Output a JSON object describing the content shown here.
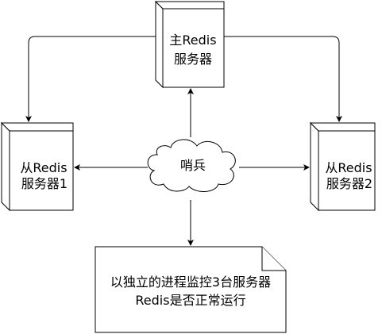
{
  "diagram": {
    "master": {
      "line1": "主Redis",
      "line2": "服务器"
    },
    "slave1": {
      "line1": "从Redis",
      "line2": "服务器1"
    },
    "slave2": {
      "line1": "从Redis",
      "line2": "服务器2"
    },
    "sentinel": {
      "label": "哨兵"
    },
    "note": {
      "line1": "以独立的进程监控3台服务器",
      "line2": "Redis是否正常运行"
    }
  },
  "colors": {
    "stroke": "#000000",
    "fill": "#ffffff"
  }
}
